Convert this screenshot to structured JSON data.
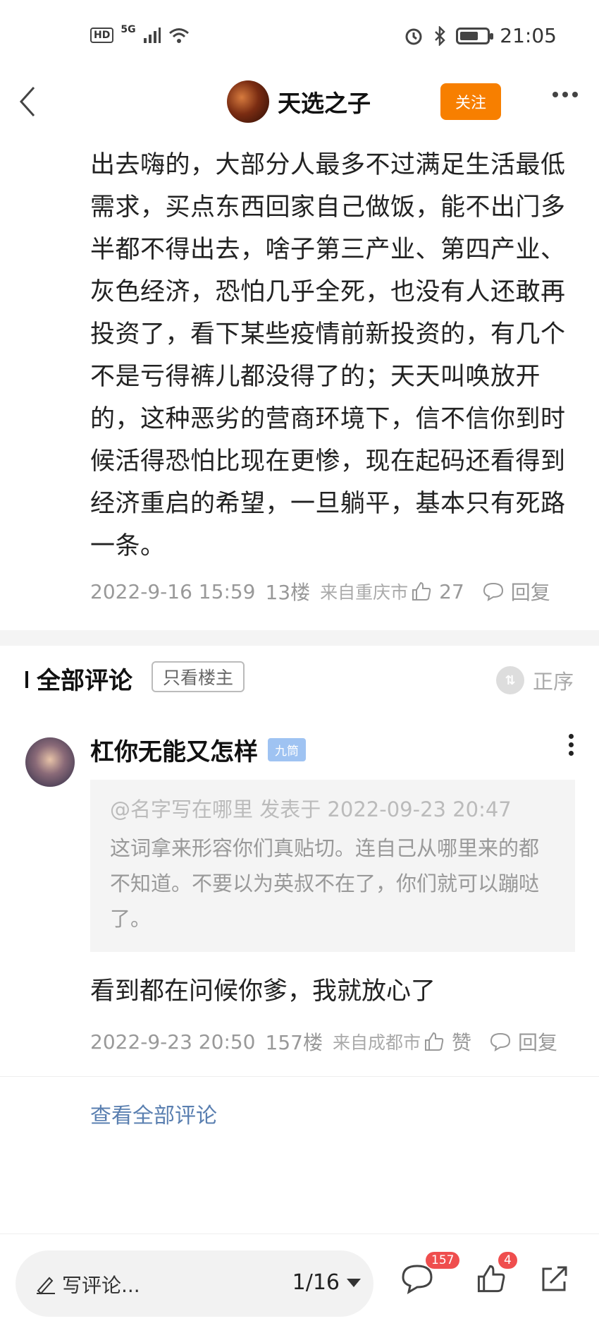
{
  "status_bar": {
    "hd": "HD",
    "network": "5G",
    "time": "21:05",
    "battery_level": 0.7
  },
  "header": {
    "author_name": "天选之子",
    "follow_label": "关注"
  },
  "post": {
    "body": "出去嗨的，大部分人最多不过满足生活最低需求，买点东西回家自己做饭，能不出门多半都不得出去，啥子第三产业、第四产业、灰色经济，恐怕几乎全死，也没有人还敢再投资了，看下某些疫情前新投资的，有几个不是亏得裤儿都没得了的；天天叫唤放开的，这种恶劣的营商环境下，信不信你到时候活得恐怕比现在更惨，现在起码还看得到经济重启的希望，一旦躺平，基本只有死路一条。",
    "date": "2022-9-16 15:59",
    "floor": "13楼",
    "location": "来自重庆市",
    "likes": "27",
    "reply_label": "回复"
  },
  "comments_header": {
    "title": "全部评论",
    "only_op_label": "只看楼主",
    "sort_label": "正序"
  },
  "comment": {
    "user_name": "杠你无能又怎样",
    "level_badge": "九筒",
    "quote_header": "@名字写在哪里 发表于 2022-09-23 20:47",
    "quote_text": "这词拿来形容你们真贴切。连自己从哪里来的都不知道。不要以为英叔不在了，你们就可以蹦哒了。",
    "text": "看到都在问候你爹，我就放心了",
    "date": "2022-9-23 20:50",
    "floor": "157楼",
    "location": "来自成都市",
    "like_label": "赞",
    "reply_label": "回复"
  },
  "view_all_label": "查看全部评论",
  "bottom_bar": {
    "write_label": "写评论...",
    "page_indicator": "1/16",
    "comment_count": "157",
    "like_count": "4"
  }
}
